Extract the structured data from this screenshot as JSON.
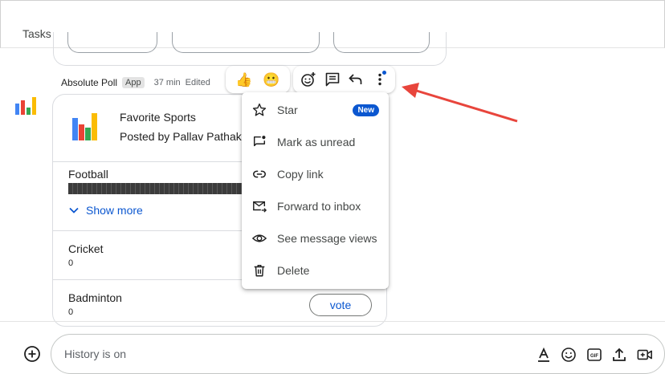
{
  "header": {
    "title": "Tasks"
  },
  "message": {
    "sender": "Absolute Poll",
    "sender_badge": "App",
    "time": "37 min",
    "edited": "Edited"
  },
  "poll": {
    "title": "Favorite Sports",
    "author": "Posted by Pallav Pathak",
    "options": [
      {
        "name": "Football",
        "fill_fraction": 1.0
      },
      {
        "name": "Cricket",
        "count": "0"
      },
      {
        "name": "Badminton",
        "count": "0"
      }
    ],
    "show_more_label": "Show more",
    "vote_label": "vote"
  },
  "reactions": [
    "👍",
    "😬"
  ],
  "context_menu": {
    "items": [
      {
        "label": "Star",
        "icon": "star-icon",
        "badge": "New"
      },
      {
        "label": "Mark as unread",
        "icon": "mark-unread-icon"
      },
      {
        "label": "Copy link",
        "icon": "link-icon"
      },
      {
        "label": "Forward to inbox",
        "icon": "forward-mail-icon"
      },
      {
        "label": "See message views",
        "icon": "eye-icon"
      },
      {
        "label": "Delete",
        "icon": "trash-icon"
      }
    ]
  },
  "composer": {
    "placeholder": "History is on"
  },
  "colors": {
    "accent": "#0b57d0",
    "arrow": "#e8453c",
    "logo_blue": "#4285f4",
    "logo_red": "#ea4335",
    "logo_yellow": "#fbbc04",
    "logo_green": "#34a853"
  }
}
